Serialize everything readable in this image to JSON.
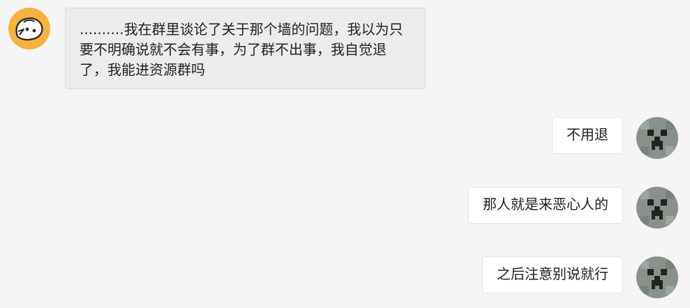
{
  "messages": [
    {
      "side": "incoming",
      "avatar_icon": "cartoon-face-avatar-icon",
      "text": "..........我在群里谈论了关于那个墙的问题，我以为只要不明确说就不会有事，为了群不出事，我自觉退了，我能进资源群吗"
    },
    {
      "side": "outgoing",
      "avatar_icon": "creeper-face-avatar-icon",
      "text": "不用退"
    },
    {
      "side": "outgoing",
      "avatar_icon": "creeper-face-avatar-icon",
      "text": "那人就是来恶心人的"
    },
    {
      "side": "outgoing",
      "avatar_icon": "creeper-face-avatar-icon",
      "text": "之后注意别说就行"
    }
  ],
  "colors": {
    "background": "#f5f5f5",
    "incoming_bubble": "#ececec",
    "outgoing_bubble": "#ffffff",
    "cartoon_avatar": "#f6b23a",
    "creeper_avatar": "#8a918b"
  }
}
